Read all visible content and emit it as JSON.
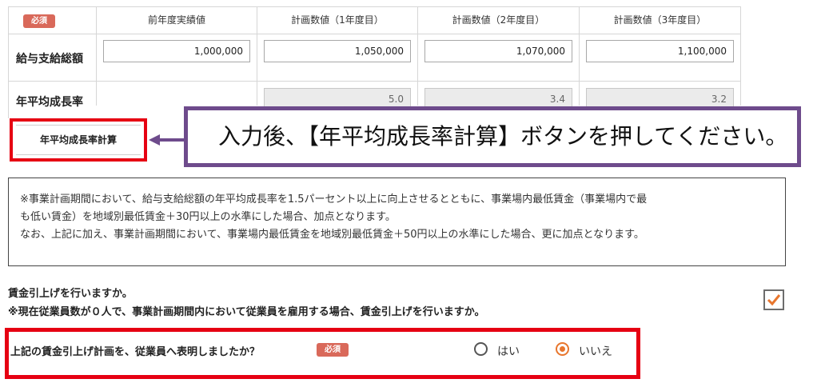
{
  "table": {
    "required_badge": "必須",
    "headers": [
      "前年度実績値",
      "計画数値（1年度目）",
      "計画数値（2年度目）",
      "計画数値（3年度目）"
    ],
    "rows": [
      {
        "label": "給与支給総額",
        "values": [
          "1,000,000",
          "1,050,000",
          "1,070,000",
          "1,100,000"
        ]
      },
      {
        "label": "年平均成長率",
        "values": [
          "",
          "5.0",
          "3.4",
          "3.2"
        ]
      }
    ]
  },
  "calc_button": {
    "label": "年平均成長率計算"
  },
  "callout": {
    "text": "入力後、【年平均成長率計算】ボタンを押してください。"
  },
  "notice": {
    "lines": [
      "※事業計画期間において、給与支給総額の年平均成長率を1.5パーセント以上に向上させるとともに、事業場内最低賃金（事業場内で最",
      "も低い賃金）を地域別最低賃金＋30円以上の水準にした場合、加点となります。",
      "なお、上記に加え、事業計画期間において、事業場内最低賃金を地域別最低賃金＋50円以上の水準にした場合、更に加点となります。"
    ]
  },
  "wage_question": {
    "title": "賃金引上げを行いますか。",
    "note": "※現在従業員数が０人で、事業計画期間内において従業員を雇用する場合、賃金引上げを行いますか。",
    "checked": true
  },
  "announce_question": {
    "text": "上記の賃金引上げ計画を、従業員へ表明しましたか？",
    "badge": "必須",
    "options": [
      "はい",
      "いいえ"
    ],
    "selected": "いいえ"
  },
  "colors": {
    "accent_red": "#e60012",
    "callout_border": "#6e4b8c",
    "badge": "#d9695a",
    "radio_selected": "#e8762d"
  }
}
